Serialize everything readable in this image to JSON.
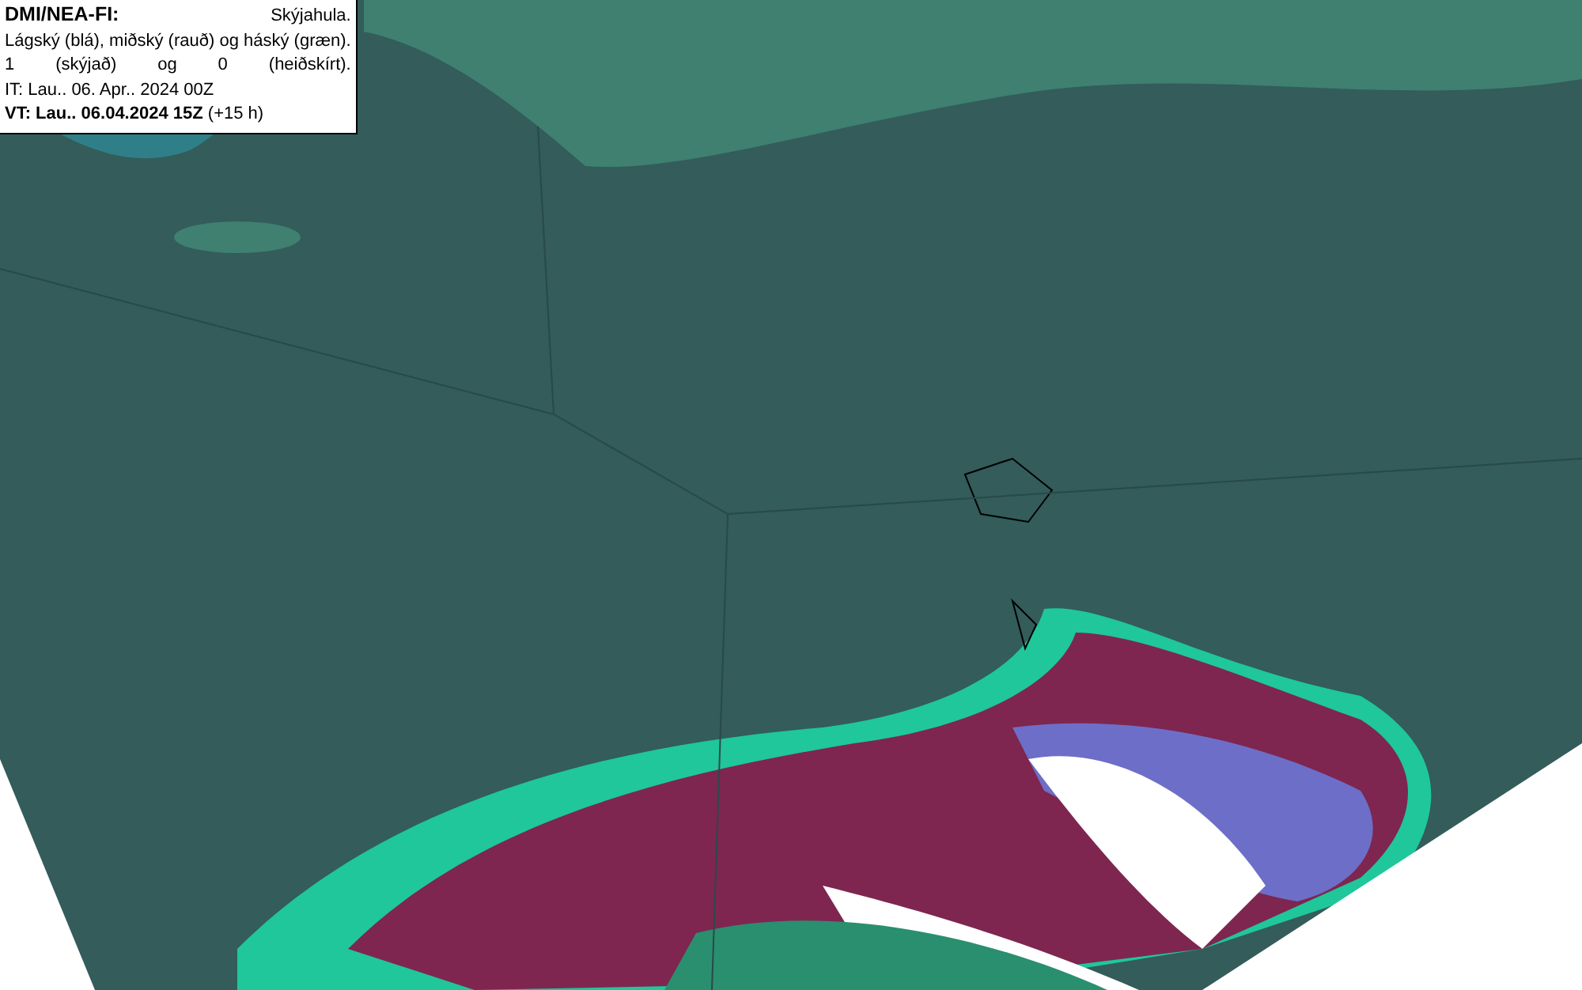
{
  "legend": {
    "source": "DMI/NEA-FI:",
    "title": "Skýjahula.",
    "description": "Lágský (blá), miðský (rauð) og háský (græn).",
    "scale_note": "1 (skýjað) og 0 (heiðskírt).",
    "issue_time": "IT: Lau.. 06. Apr.. 2024 00Z",
    "valid_time": "**VT: Lau.. 06.04.2024 15Z** (+15 h)"
  }
}
